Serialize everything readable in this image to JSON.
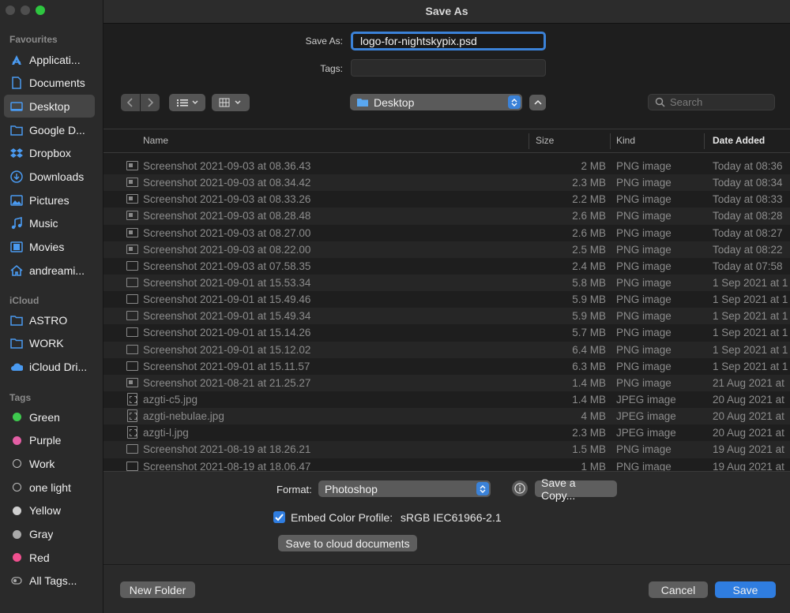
{
  "window": {
    "title": "Save As"
  },
  "sidebar": {
    "favourites_heading": "Favourites",
    "favourites": [
      {
        "label": "Applicati...",
        "icon": "applications-icon"
      },
      {
        "label": "Documents",
        "icon": "document-icon"
      },
      {
        "label": "Desktop",
        "icon": "desktop-icon",
        "selected": true
      },
      {
        "label": "Google D...",
        "icon": "folder-icon"
      },
      {
        "label": "Dropbox",
        "icon": "dropbox-icon"
      },
      {
        "label": "Downloads",
        "icon": "downloads-icon"
      },
      {
        "label": "Pictures",
        "icon": "pictures-icon"
      },
      {
        "label": "Music",
        "icon": "music-icon"
      },
      {
        "label": "Movies",
        "icon": "movies-icon"
      },
      {
        "label": "andreami...",
        "icon": "home-icon"
      }
    ],
    "icloud_heading": "iCloud",
    "icloud": [
      {
        "label": "ASTRO",
        "icon": "folder-icon"
      },
      {
        "label": "WORK",
        "icon": "folder-icon"
      },
      {
        "label": "iCloud Dri...",
        "icon": "cloud-icon"
      }
    ],
    "tags_heading": "Tags",
    "tags": [
      {
        "label": "Green",
        "color": "#3ec94e"
      },
      {
        "label": "Purple",
        "color": "#e35ea4"
      },
      {
        "label": "Work",
        "color": null
      },
      {
        "label": "one light",
        "color": null
      },
      {
        "label": "Yellow",
        "color": "#cfcfcf"
      },
      {
        "label": "Gray",
        "color": "#a9a9a9"
      },
      {
        "label": "Red",
        "color": "#f0508f"
      },
      {
        "label": "All Tags...",
        "color": "all"
      }
    ]
  },
  "form": {
    "save_as_label": "Save As:",
    "save_as_value": "logo-for-nightskypix.psd",
    "tags_label": "Tags:",
    "tags_value": ""
  },
  "toolbar": {
    "location": "Desktop",
    "search_placeholder": "Search"
  },
  "table": {
    "columns": [
      "Name",
      "Size",
      "Kind",
      "Date Added"
    ],
    "rows": [
      {
        "name": "Screenshot 2021-09-03 at 08.36.43",
        "size": "2 MB",
        "kind": "PNG image",
        "date": "Today at 08:36",
        "icon": "img"
      },
      {
        "name": "Screenshot 2021-09-03 at 08.34.42",
        "size": "2.3 MB",
        "kind": "PNG image",
        "date": "Today at 08:34",
        "icon": "img"
      },
      {
        "name": "Screenshot 2021-09-03 at 08.33.26",
        "size": "2.2 MB",
        "kind": "PNG image",
        "date": "Today at 08:33",
        "icon": "img"
      },
      {
        "name": "Screenshot 2021-09-03 at 08.28.48",
        "size": "2.6 MB",
        "kind": "PNG image",
        "date": "Today at 08:28",
        "icon": "img"
      },
      {
        "name": "Screenshot 2021-09-03 at 08.27.00",
        "size": "2.6 MB",
        "kind": "PNG image",
        "date": "Today at 08:27",
        "icon": "img"
      },
      {
        "name": "Screenshot 2021-09-03 at 08.22.00",
        "size": "2.5 MB",
        "kind": "PNG image",
        "date": "Today at 08:22",
        "icon": "img"
      },
      {
        "name": "Screenshot 2021-09-03 at 07.58.35",
        "size": "2.4 MB",
        "kind": "PNG image",
        "date": "Today at 07:58",
        "icon": "plain"
      },
      {
        "name": "Screenshot 2021-09-01 at 15.53.34",
        "size": "5.8 MB",
        "kind": "PNG image",
        "date": "1 Sep 2021 at 1",
        "icon": "plain"
      },
      {
        "name": "Screenshot 2021-09-01 at 15.49.46",
        "size": "5.9 MB",
        "kind": "PNG image",
        "date": "1 Sep 2021 at 1",
        "icon": "plain"
      },
      {
        "name": "Screenshot 2021-09-01 at 15.49.34",
        "size": "5.9 MB",
        "kind": "PNG image",
        "date": "1 Sep 2021 at 1",
        "icon": "plain"
      },
      {
        "name": "Screenshot 2021-09-01 at 15.14.26",
        "size": "5.7 MB",
        "kind": "PNG image",
        "date": "1 Sep 2021 at 1",
        "icon": "plain"
      },
      {
        "name": "Screenshot 2021-09-01 at 15.12.02",
        "size": "6.4 MB",
        "kind": "PNG image",
        "date": "1 Sep 2021 at 1",
        "icon": "plain"
      },
      {
        "name": "Screenshot 2021-09-01 at 15.11.57",
        "size": "6.3 MB",
        "kind": "PNG image",
        "date": "1 Sep 2021 at 1",
        "icon": "plain"
      },
      {
        "name": "Screenshot 2021-08-21 at 21.25.27",
        "size": "1.4 MB",
        "kind": "PNG image",
        "date": "21 Aug 2021 at",
        "icon": "img"
      },
      {
        "name": "azgti-c5.jpg",
        "size": "1.4 MB",
        "kind": "JPEG image",
        "date": "20 Aug 2021 at",
        "icon": "jpg"
      },
      {
        "name": "azgti-nebulae.jpg",
        "size": "4 MB",
        "kind": "JPEG image",
        "date": "20 Aug 2021 at",
        "icon": "jpg"
      },
      {
        "name": "azgti-l.jpg",
        "size": "2.3 MB",
        "kind": "JPEG image",
        "date": "20 Aug 2021 at",
        "icon": "jpg"
      },
      {
        "name": "Screenshot 2021-08-19 at 18.26.21",
        "size": "1.5 MB",
        "kind": "PNG image",
        "date": "19 Aug 2021 at",
        "icon": "plain"
      },
      {
        "name": "Screenshot 2021-08-19 at 18.06.47",
        "size": "1 MB",
        "kind": "PNG image",
        "date": "19 Aug 2021 at",
        "icon": "plain"
      }
    ]
  },
  "options": {
    "format_label": "Format:",
    "format_value": "Photoshop",
    "save_copy_label": "Save a Copy...",
    "embed_label": "Embed Color Profile:",
    "embed_value": "sRGB IEC61966-2.1",
    "embed_checked": true,
    "cloud_label": "Save to cloud documents"
  },
  "footer": {
    "new_folder_label": "New Folder",
    "cancel_label": "Cancel",
    "save_label": "Save"
  }
}
